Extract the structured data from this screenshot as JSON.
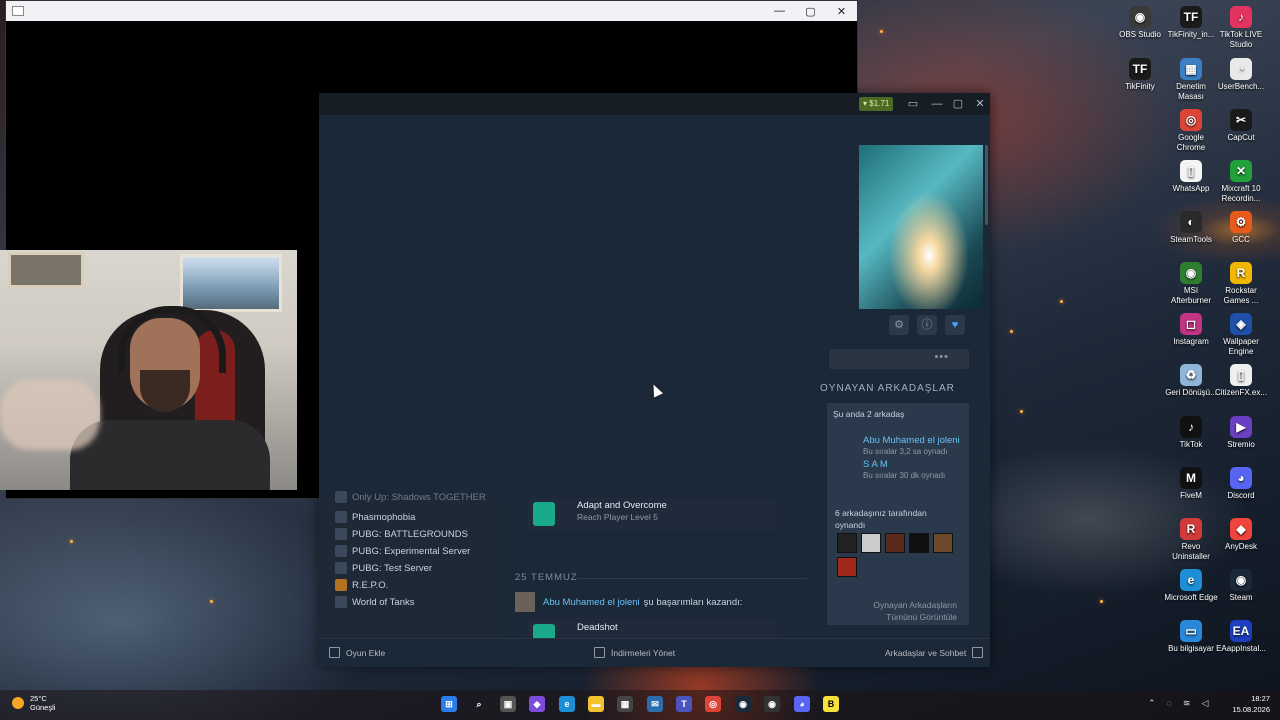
{
  "desktop": {
    "icons": [
      {
        "label": "OBS Studio",
        "icon": "obs-icon",
        "color": "#3a3a3a",
        "glyph": "◉"
      },
      {
        "label": "TikFinity_in...",
        "icon": "tikfinity-icon",
        "color": "#1a1a1a",
        "glyph": "TF"
      },
      {
        "label": "TikTok LIVE Studio",
        "icon": "tiktok-live-icon",
        "color": "#e3335f",
        "glyph": "♪"
      },
      {
        "label": "TikFinity",
        "icon": "tikfinity-icon",
        "color": "#1a1a1a",
        "glyph": "TF"
      },
      {
        "label": "Denetim Masası",
        "icon": "control-panel-icon",
        "color": "#3c7fc4",
        "glyph": "▦"
      },
      {
        "label": "UserBench...",
        "icon": "userbenchmark-icon",
        "color": "#e9e9e9",
        "glyph": "◔"
      },
      {
        "label": "Google Chrome",
        "icon": "chrome-icon",
        "color": "#db4437",
        "glyph": "◎"
      },
      {
        "label": "CapCut",
        "icon": "capcut-icon",
        "color": "#1a1a1a",
        "glyph": "✂"
      },
      {
        "label": "WhatsApp",
        "icon": "whatsapp-icon",
        "color": "#f4f4f4",
        "glyph": "▯"
      },
      {
        "label": "Mixcraft 10 Recordin...",
        "icon": "mixcraft-icon",
        "color": "#22a03a",
        "glyph": "✕"
      },
      {
        "label": "SteamTools",
        "icon": "steamtools-icon",
        "color": "#2a2a2a",
        "glyph": "◐"
      },
      {
        "label": "GCC",
        "icon": "gcc-icon",
        "color": "#e85a1c",
        "glyph": "⚙"
      },
      {
        "label": "MSI Afterburner",
        "icon": "msi-afterburner-icon",
        "color": "#2f7d2f",
        "glyph": "◉"
      },
      {
        "label": "Rockstar Games ...",
        "icon": "rockstar-icon",
        "color": "#f2b705",
        "glyph": "R"
      },
      {
        "label": "Instagram",
        "icon": "instagram-icon",
        "color": "#c13584",
        "glyph": "◻"
      },
      {
        "label": "Wallpaper Engine",
        "icon": "wallpaper-engine-icon",
        "color": "#1f4fa8",
        "glyph": "◈"
      },
      {
        "label": "Geri Dönüşü...",
        "icon": "recycle-bin-icon",
        "color": "#8fb6d9",
        "glyph": "♻"
      },
      {
        "label": "CitizenFX.ex...",
        "icon": "file-icon",
        "color": "#efefef",
        "glyph": "▯"
      },
      {
        "label": "TikTok",
        "icon": "tiktok-icon",
        "color": "#111111",
        "glyph": "♪"
      },
      {
        "label": "Stremio",
        "icon": "stremio-icon",
        "color": "#6a3fc1",
        "glyph": "▶"
      },
      {
        "label": "FiveM",
        "icon": "fivem-icon",
        "color": "#111111",
        "glyph": "M"
      },
      {
        "label": "Discord",
        "icon": "discord-icon",
        "color": "#5865f2",
        "glyph": "◕"
      },
      {
        "label": "Revo Uninstaller",
        "icon": "revo-icon",
        "color": "#d23a3a",
        "glyph": "R"
      },
      {
        "label": "AnyDesk",
        "icon": "anydesk-icon",
        "color": "#ef443b",
        "glyph": "◆"
      },
      {
        "label": "Microsoft Edge",
        "icon": "edge-icon",
        "color": "#1c8fd4",
        "glyph": "e"
      },
      {
        "label": "Steam",
        "icon": "steam-icon",
        "color": "#1b2838",
        "glyph": "◉"
      },
      {
        "label": "Bu bilgisayar",
        "icon": "this-pc-icon",
        "color": "#2b88d8",
        "glyph": "▭"
      },
      {
        "label": "EAappInstal...",
        "icon": "ea-icon",
        "color": "#1d3fbf",
        "glyph": "EA"
      }
    ]
  },
  "steam": {
    "wallet": "$1.71",
    "friends_heading": "OYNAYAN ARKADAŞLAR",
    "friends_now": "Şu anda 2 arkadaş",
    "friends": [
      {
        "name": "Abu Muhamed el joleni",
        "status": "Bu sıralar 3,2 sa oynadı"
      },
      {
        "name": "S A M",
        "status": "Bu sıralar 30 dk oynadı"
      }
    ],
    "played_by": "6 arkadaşınız tarafından oynandı",
    "show_all_line1": "Oynayan Arkadaşların",
    "show_all_line2": "Tümünü Görüntüle",
    "games": [
      {
        "name": "Only Up: Shadows TOGETHER",
        "faded": true
      },
      {
        "name": "Phasmophobia",
        "faded": false
      },
      {
        "name": "PUBG: BATTLEGROUNDS",
        "faded": false
      },
      {
        "name": "PUBG: Experimental Server",
        "faded": false
      },
      {
        "name": "PUBG: Test Server",
        "faded": false
      },
      {
        "name": "R.E.P.O.",
        "faded": false
      },
      {
        "name": "World of Tanks",
        "faded": false
      }
    ],
    "achievement": {
      "title": "Adapt and Overcome",
      "desc": "Reach Player Level 5"
    },
    "date": "25 TEMMUZ",
    "feed_user": "Abu Muhamed el joleni",
    "feed_text": "şu başarımları kazandı:",
    "achievement2": "Deadshot",
    "bottom": {
      "add_game": "Oyun Ekle",
      "downloads": "İndirmeleri Yönet",
      "friends_chat": "Arkadaşlar ve Sohbet"
    }
  },
  "taskbar": {
    "temp": "25°C",
    "weather": "Güneşli",
    "time": "18:27",
    "date": "15.08.2026"
  }
}
